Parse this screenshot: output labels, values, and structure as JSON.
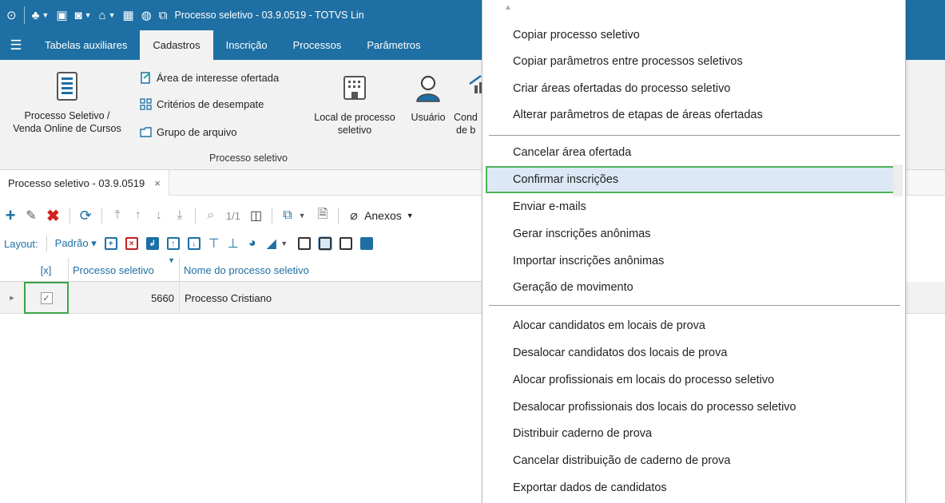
{
  "window": {
    "title": "Processo seletivo - 03.9.0519 - TOTVS Lin"
  },
  "ribbon_tabs": [
    {
      "label": "Tabelas auxiliares"
    },
    {
      "label": "Cadastros"
    },
    {
      "label": "Inscrição"
    },
    {
      "label": "Processos"
    },
    {
      "label": "Parâmetros"
    }
  ],
  "ribbon": {
    "processo_line1": "Processo Seletivo /",
    "processo_line2": "Venda Online de Cursos",
    "area_interesse": "Área de interesse ofertada",
    "criterios": "Critérios de desempate",
    "grupo_arquivo": "Grupo de arquivo",
    "local_line1": "Local de processo",
    "local_line2": "seletivo",
    "usuario": "Usuário",
    "cond_line1": "Cond",
    "cond_line2": "de b",
    "group_label": "Processo seletivo"
  },
  "doc_tab": {
    "label": "Processo seletivo - 03.9.0519",
    "close": "×"
  },
  "toolbar": {
    "pager": "1/1",
    "anexos": "Anexos",
    "layout_label": "Layout:",
    "layout_value": "Padrão ▾"
  },
  "grid": {
    "columns": [
      "[x]",
      "Processo seletivo",
      "Nome do processo seletivo"
    ],
    "rows": [
      {
        "checked": true,
        "id": "5660",
        "name": "Processo Cristiano"
      }
    ]
  },
  "menu": {
    "groups": [
      [
        "Copiar processo seletivo",
        "Copiar parâmetros entre processos seletivos",
        "Criar áreas ofertadas do processo seletivo",
        "Alterar parâmetros de etapas de áreas ofertadas"
      ],
      [
        "Cancelar área ofertada",
        "Confirmar inscrições",
        "Enviar e-mails",
        "Gerar inscrições anônimas",
        "Importar inscrições anônimas",
        "Geração de movimento"
      ],
      [
        "Alocar candidatos em locais de prova",
        "Desalocar candidatos dos locais de prova",
        "Alocar profissionais em locais do processo seletivo",
        "Desalocar profissionais dos locais do processo seletivo",
        "Distribuir caderno de prova",
        "Cancelar distribuição de caderno de prova",
        "Exportar dados de candidatos"
      ]
    ],
    "highlighted": "Confirmar inscrições"
  },
  "colors": {
    "brand": "#1e6fa3",
    "highlight_border": "#4cb257",
    "highlight_bg": "#dce8f5"
  }
}
